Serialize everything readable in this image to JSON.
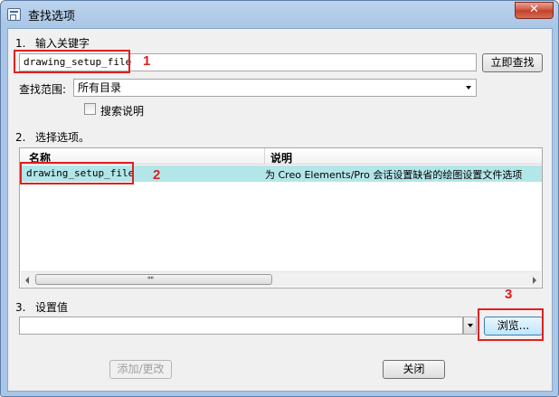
{
  "window": {
    "title": "查找选项",
    "close_symbol": "✕"
  },
  "section1": {
    "label": "输入关键字",
    "number": "1.",
    "keyword_value": "drawing_setup_file",
    "search_button": "立即查找"
  },
  "scope": {
    "label": "查找范围:",
    "selected": "所有目录",
    "search_desc_label": "搜索说明"
  },
  "section2": {
    "label": "选择选项。",
    "number": "2.",
    "columns": [
      "名称",
      "说明"
    ],
    "rows": [
      {
        "name": "drawing_setup_file",
        "desc": "为 Creo Elements/Pro 会话设置缺省的绘图设置文件选项"
      }
    ]
  },
  "section3": {
    "label": "设置值",
    "number": "3.",
    "value": "",
    "browse_button": "浏览..."
  },
  "footer": {
    "apply_button": "添加/更改",
    "close_button": "关闭"
  },
  "annotations": {
    "one": "1",
    "two": "2",
    "three": "3",
    "color": "#e02020"
  }
}
